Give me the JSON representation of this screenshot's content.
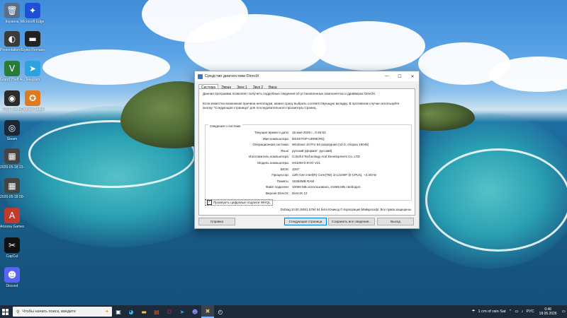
{
  "desktop": {
    "icons": [
      {
        "label": "Корзина",
        "glyph": "🗑",
        "color": "#5a6f8c"
      },
      {
        "label": "Microsoft Edge IV",
        "glyph": "✦",
        "color": "#1e4fd6"
      },
      {
        "label": "Presentation Assistant",
        "glyph": "◐",
        "color": "#3b3b3b"
      },
      {
        "label": "Crysis Remastered",
        "glyph": "▬",
        "color": "#222222"
      },
      {
        "label": "Grand Theft Auto V",
        "glyph": "V",
        "color": "#2a7a3a"
      },
      {
        "label": "Telegram",
        "glyph": "➤",
        "color": "#2aa3e0"
      },
      {
        "label": "OBS Studio",
        "glyph": "◉",
        "color": "#2b2b2b"
      },
      {
        "label": "Counter-Strike 2",
        "glyph": "✪",
        "color": "#e07a1f"
      },
      {
        "label": "Steam",
        "glyph": "◎",
        "color": "#1b2838"
      },
      {
        "label": "2026-05-18 23-02-32",
        "glyph": "▦",
        "color": "#444444"
      },
      {
        "label": "2026-05-18 00-17-43",
        "glyph": "▦",
        "color": "#444444"
      },
      {
        "label": "Arizona Games",
        "glyph": "A",
        "color": "#c23a2e"
      },
      {
        "label": "CapCut",
        "glyph": "✂",
        "color": "#111111"
      },
      {
        "label": "Discord",
        "glyph": "☻",
        "color": "#5865f2"
      }
    ]
  },
  "window": {
    "title": "Средство диагностики DirectX",
    "tabs": [
      "Система",
      "Экран",
      "Звук 1",
      "Звук 2",
      "Ввод"
    ],
    "intro1": "Данная программа позволяет получить подробные сведения об установленных компонентах и драйверах DirectX.",
    "intro2": "Если известна возможная причина неполадки, можно сразу выбрать соответствующую вкладку. В противном случае используйте кнопку \"Следующая страница\" для последовательного просмотра страниц.",
    "group_title": "Сведения о системе",
    "rows": [
      {
        "k": "Текущие время и дата:",
        "v": "18 мая 2026 г., 0:45:52"
      },
      {
        "k": "Имя компьютера:",
        "v": "DESKTOP-UR99ORQ"
      },
      {
        "k": "Операционная система:",
        "v": "Windows 10 Pro 64-разрядная (10.0, сборка 19045)"
      },
      {
        "k": "Язык:",
        "v": "русский (формат: русский)"
      },
      {
        "k": "Изготовитель компьютера:",
        "v": "Colorful Technology And Development Co.,LTD"
      },
      {
        "k": "Модель компьютера:",
        "v": "H610M-D EVO V21"
      },
      {
        "k": "BIOS:",
        "v": "1007"
      },
      {
        "k": "Процессор:",
        "v": "12th Gen Intel(R) Core(TM) i3-12100F (8 CPUs), ~3.3GHz"
      },
      {
        "k": "Память:",
        "v": "16384MB RAM"
      },
      {
        "k": "Файл подкачки:",
        "v": "10059 МБ использовано, 21685 МБ свободно"
      },
      {
        "k": "Версия DirectX:",
        "v": "DirectX 12"
      }
    ],
    "checkbox_label": "Проверить цифровые подписи WHQL",
    "checkbox_checked": true,
    "footer": "DxDiag 10.00.19041.5794 64 бита Юникод  © Корпорация Майкрософт. Все права защищены.",
    "buttons": {
      "help": "Справка",
      "next": "Следующая страница",
      "save": "Сохранить все сведения...",
      "exit": "Выход"
    }
  },
  "taskbar": {
    "search_placeholder": "Чтобы начать поиск, введите",
    "weather": "1 cm of rain Sat",
    "lang": "РУС",
    "time": "0:46",
    "date": "18.05.2026"
  }
}
